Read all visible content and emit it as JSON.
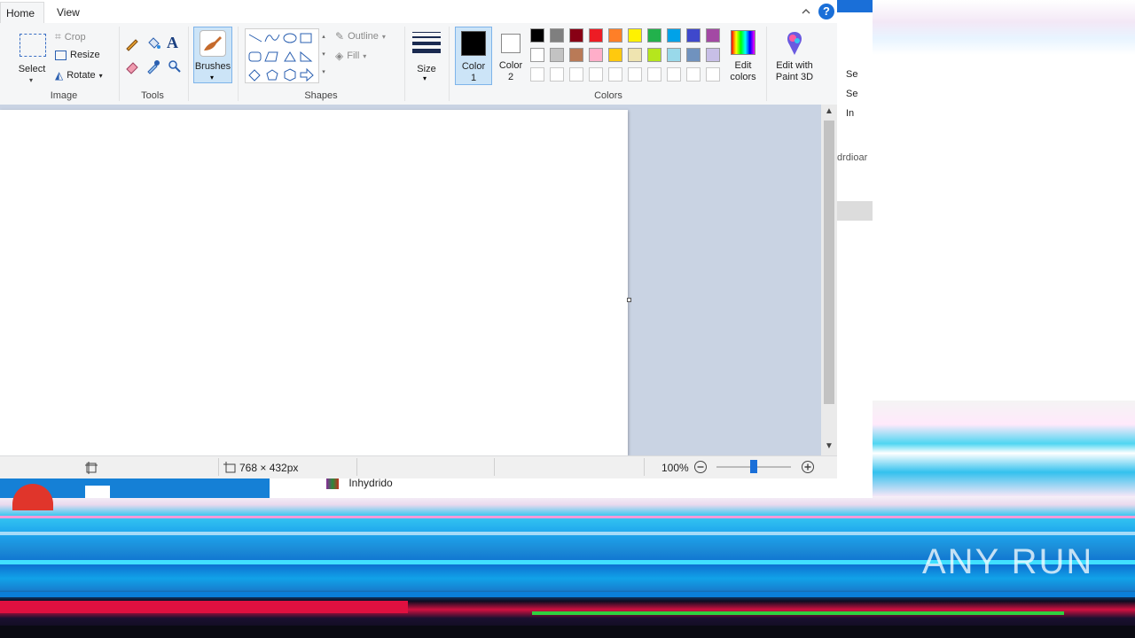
{
  "window": {
    "tabs": [
      {
        "label": "Home"
      },
      {
        "label": "View"
      }
    ],
    "help_glyph": "?"
  },
  "ribbon": {
    "image": {
      "group_label": "Image",
      "select_label": "Select",
      "crop_label": "Crop",
      "resize_label": "Resize",
      "rotate_label": "Rotate"
    },
    "tools": {
      "group_label": "Tools"
    },
    "brushes": {
      "label": "Brushes"
    },
    "shapes": {
      "group_label": "Shapes",
      "outline_label": "Outline",
      "fill_label": "Fill"
    },
    "size": {
      "label": "Size"
    },
    "colors": {
      "group_label": "Colors",
      "color1_label": "Color",
      "color1_num": "1",
      "color2_label": "Color",
      "color2_num": "2",
      "color1_value": "#000000",
      "color2_value": "#ffffff",
      "palette_row1": [
        "#000000",
        "#7f7f7f",
        "#880015",
        "#ed1c24",
        "#ff7f27",
        "#fff200",
        "#22b14c",
        "#00a2e8",
        "#3f48cc",
        "#a349a4"
      ],
      "palette_row2": [
        "#ffffff",
        "#c3c3c3",
        "#b97a57",
        "#ffaec9",
        "#ffc90e",
        "#efe4b0",
        "#b5e61d",
        "#99d9ea",
        "#7092be",
        "#c8bfe7"
      ],
      "edit_colors_line1": "Edit",
      "edit_colors_line2": "colors"
    },
    "paint3d": {
      "line1": "Edit with",
      "line2": "Paint 3D"
    }
  },
  "status": {
    "canvas_size": "768 × 432px",
    "zoom": "100%",
    "zoom_slider_fraction": 0.5
  },
  "background": {
    "side_items": [
      "Se",
      "Se",
      "In"
    ],
    "side_text": "drdioar",
    "taskbar_item": "Inhydrido",
    "watermark": "ANY RUN"
  }
}
